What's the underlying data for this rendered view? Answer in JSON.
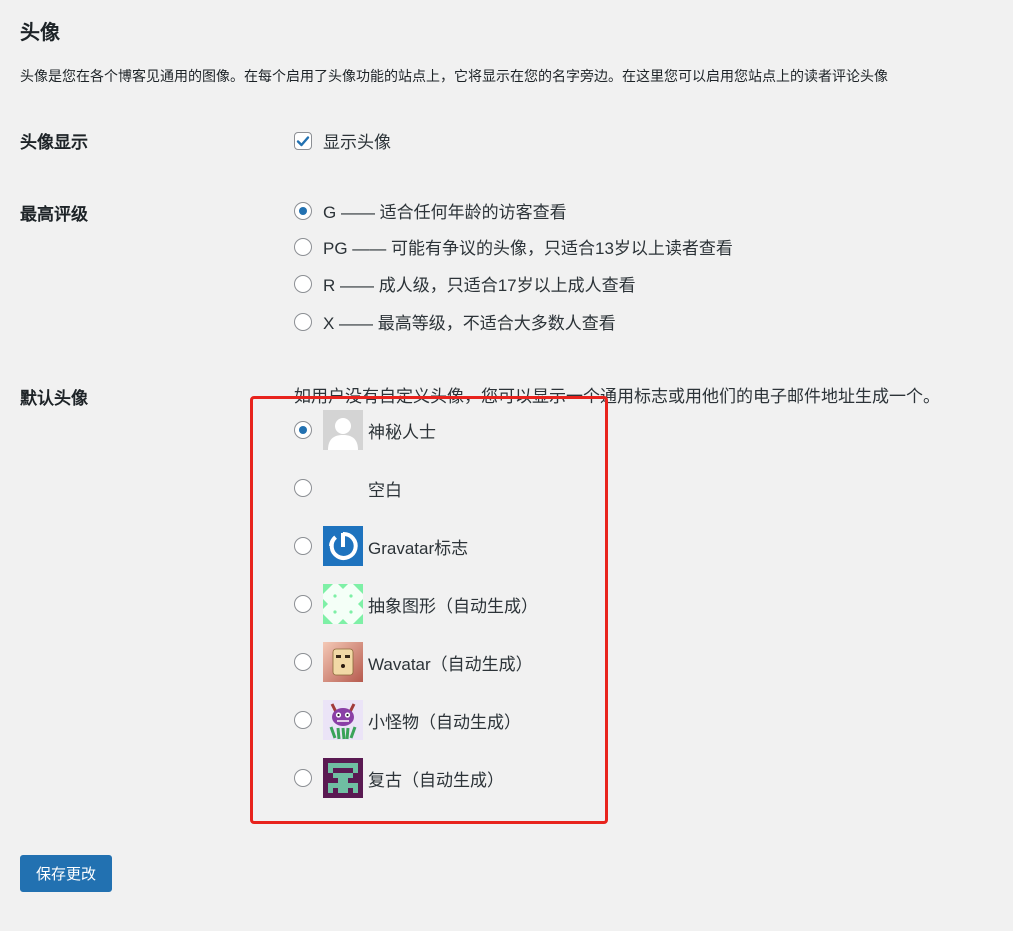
{
  "section": {
    "title": "头像",
    "description": "头像是您在各个博客见通用的图像。在每个启用了头像功能的站点上，它将显示在您的名字旁边。在这里您可以启用您站点上的读者评论头像"
  },
  "avatar_display": {
    "label": "头像显示",
    "checkbox_label": "显示头像",
    "checked": true
  },
  "max_rating": {
    "label": "最高评级",
    "options": [
      {
        "label": "G —— 适合任何年龄的访客查看",
        "checked": true
      },
      {
        "label": "PG —— 可能有争议的头像，只适合13岁以上读者查看",
        "checked": false
      },
      {
        "label": "R —— 成人级，只适合17岁以上成人查看",
        "checked": false
      },
      {
        "label": "X —— 最高等级，不适合大多数人查看",
        "checked": false
      }
    ]
  },
  "default_avatar": {
    "label": "默认头像",
    "description": "如用户没有自定义头像，您可以显示一个通用标志或用他们的电子邮件地址生成一个。",
    "options": [
      {
        "label": "神秘人士",
        "icon": "mystery-person-icon",
        "checked": true
      },
      {
        "label": "空白",
        "icon": "blank-icon",
        "checked": false
      },
      {
        "label": "Gravatar标志",
        "icon": "gravatar-logo-icon",
        "checked": false
      },
      {
        "label": "抽象图形（自动生成）",
        "icon": "identicon-icon",
        "checked": false
      },
      {
        "label": "Wavatar（自动生成）",
        "icon": "wavatar-icon",
        "checked": false
      },
      {
        "label": "小怪物（自动生成）",
        "icon": "monsterid-icon",
        "checked": false
      },
      {
        "label": "复古（自动生成）",
        "icon": "retro-icon",
        "checked": false
      }
    ]
  },
  "save_button": {
    "label": "保存更改"
  },
  "colors": {
    "primary": "#2271b1",
    "background": "#f1f1f1",
    "highlight": "#e8231d",
    "text": "#1d2327"
  }
}
